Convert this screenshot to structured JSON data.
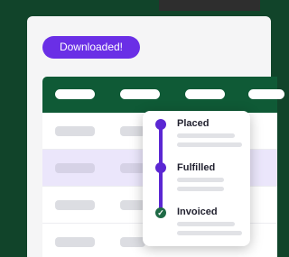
{
  "toast": {
    "label": "Downloaded!"
  },
  "order_status": {
    "steps": [
      {
        "label": "Placed",
        "state": "complete",
        "icon": "dot-icon"
      },
      {
        "label": "Fulfilled",
        "state": "complete",
        "icon": "dot-icon"
      },
      {
        "label": "Invoiced",
        "state": "done",
        "icon": "check-icon"
      }
    ]
  },
  "colors": {
    "background": "#11442a",
    "card": "#f5f5f6",
    "accent": "#6a2fe6",
    "timeline": "#5b27d3",
    "table_header": "#0f5a36",
    "row_highlight": "#ebe6fb",
    "check": "#1f6a46"
  }
}
